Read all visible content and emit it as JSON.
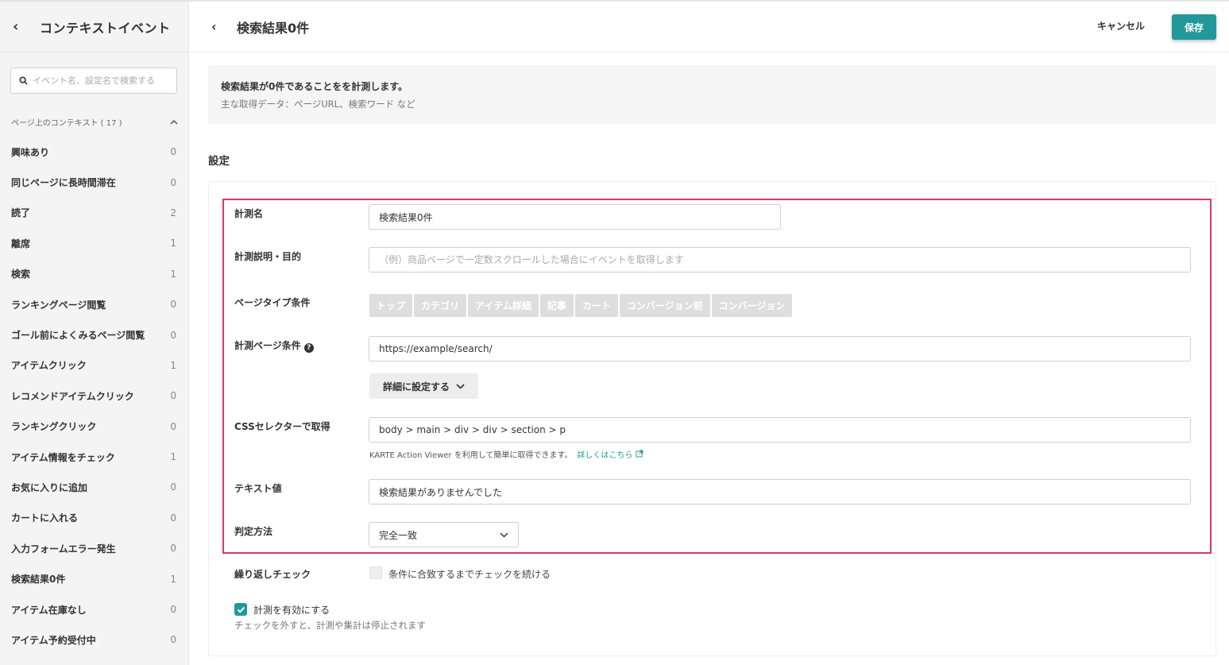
{
  "sidebar": {
    "title": "コンテキストイベント",
    "search_placeholder": "イベント名、設定名で検索する",
    "group_label": "ページ上のコンテキスト ( 17 )",
    "items": [
      {
        "label": "興味あり",
        "count": "0"
      },
      {
        "label": "同じページに長時間滞在",
        "count": "0"
      },
      {
        "label": "読了",
        "count": "2"
      },
      {
        "label": "離席",
        "count": "1"
      },
      {
        "label": "検索",
        "count": "1"
      },
      {
        "label": "ランキングページ閲覧",
        "count": "0"
      },
      {
        "label": "ゴール前によくみるページ閲覧",
        "count": "0"
      },
      {
        "label": "アイテムクリック",
        "count": "1"
      },
      {
        "label": "レコメンドアイテムクリック",
        "count": "0"
      },
      {
        "label": "ランキングクリック",
        "count": "0"
      },
      {
        "label": "アイテム情報をチェック",
        "count": "1"
      },
      {
        "label": "お気に入りに追加",
        "count": "0"
      },
      {
        "label": "カートに入れる",
        "count": "0"
      },
      {
        "label": "入力フォームエラー発生",
        "count": "0"
      },
      {
        "label": "検索結果0件",
        "count": "1"
      },
      {
        "label": "アイテム在庫なし",
        "count": "0"
      },
      {
        "label": "アイテム予約受付中",
        "count": "0"
      }
    ]
  },
  "header": {
    "title": "検索結果0件",
    "cancel_label": "キャンセル",
    "save_label": "保存",
    "save_color": "#23989a"
  },
  "description": {
    "line1": "検索結果が0件であることをを計測します。",
    "line2": "主な取得データ：ページURL、検索ワード など"
  },
  "settings": {
    "section_title": "設定",
    "highlight_color": "#e0336e",
    "name_label": "計測名",
    "name_value": "検索結果0件",
    "purpose_label": "計測説明・目的",
    "purpose_placeholder": "（例）商品ページで一定数スクロールした場合にイベントを取得します",
    "page_type_label": "ページタイプ条件",
    "page_types": [
      "トップ",
      "カテゴリ",
      "アイテム詳細",
      "記事",
      "カート",
      "コンバージョン前",
      "コンバージョン"
    ],
    "page_cond_label": "計測ページ条件",
    "page_cond_value": "https://example/search/",
    "advanced_label": "詳細に設定する",
    "css_label": "CSSセレクターで取得",
    "css_value": "body > main > div > div > section > p",
    "css_hint": "KARTE Action Viewer を利用して簡単に取得できます。",
    "css_link": "詳しくはこちら",
    "text_label": "テキスト値",
    "text_value": "検索結果がありませんでした",
    "method_label": "判定方法",
    "method_value": "完全一致",
    "repeat_label": "繰り返しチェック",
    "repeat_text": "条件に合致するまでチェックを続ける",
    "enable_text": "計測を有効にする",
    "enable_note": "チェックを外すと、計測や集計は停止されます"
  }
}
